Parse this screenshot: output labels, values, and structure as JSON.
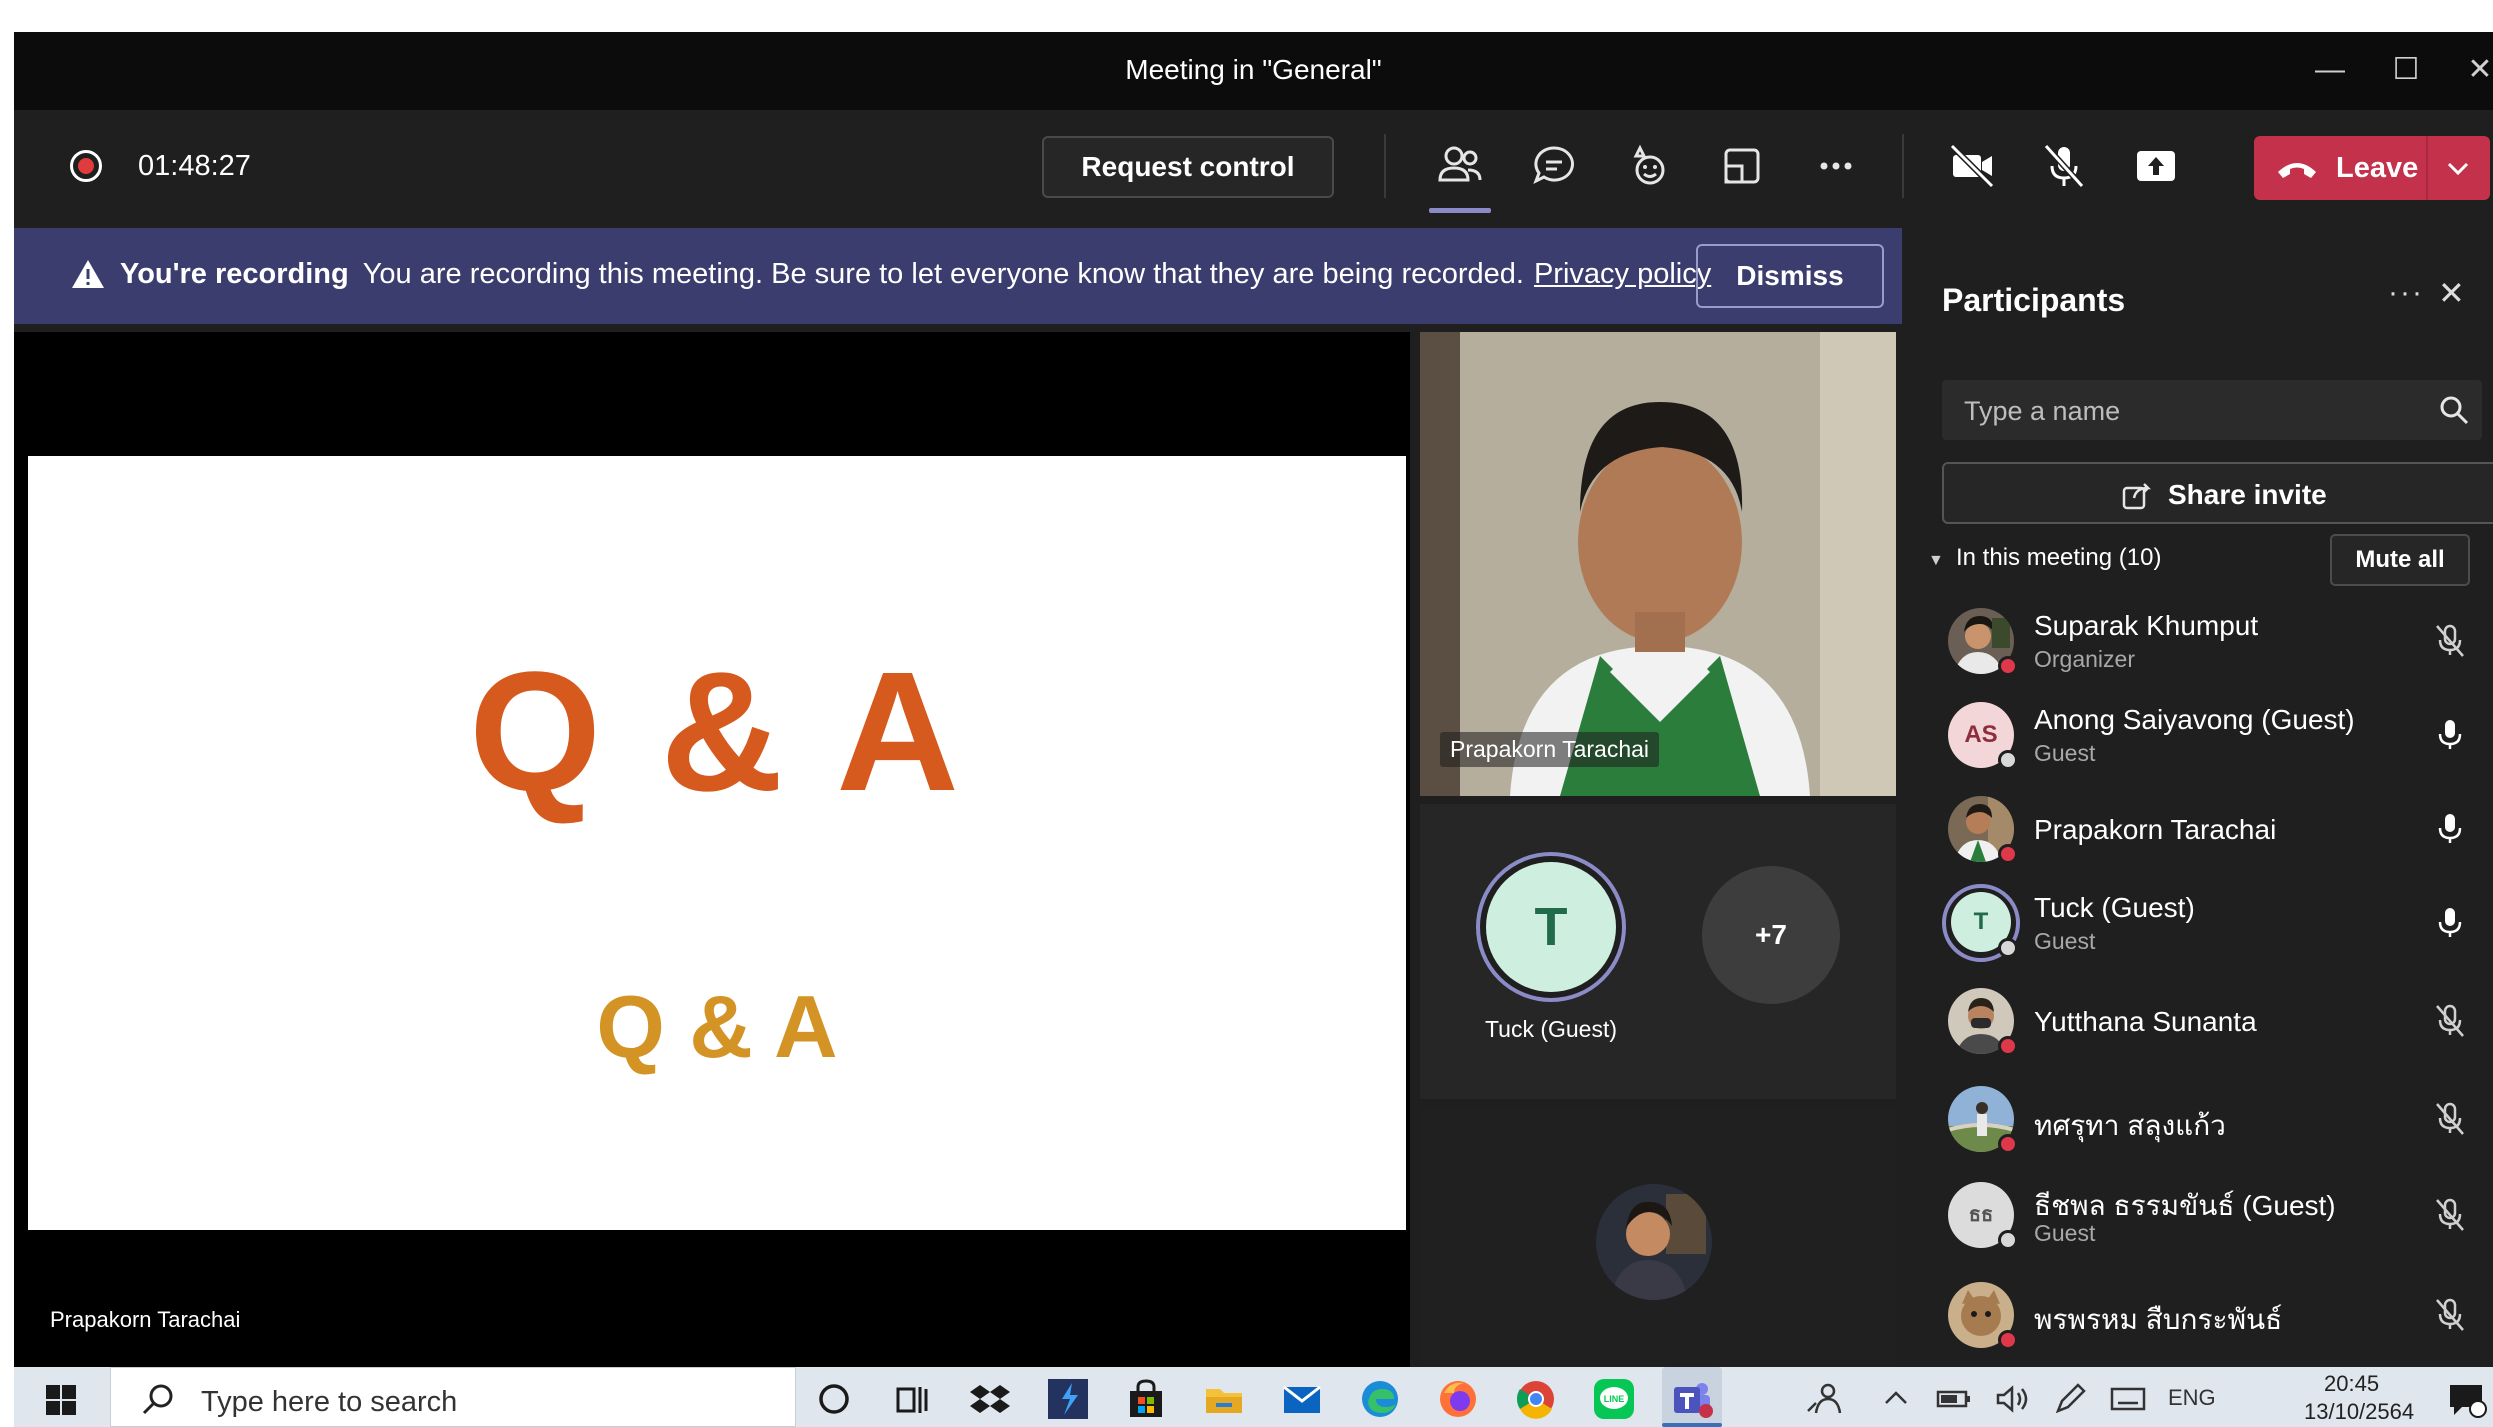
{
  "window": {
    "title": "Meeting in \"General\"",
    "controls": [
      "minimize-icon",
      "maximize-icon",
      "close-icon"
    ]
  },
  "toolbar": {
    "timer": "01:48:27",
    "request_control_label": "Request control",
    "leave_label": "Leave",
    "icons": [
      "people-icon",
      "chat-icon",
      "reactions-icon",
      "rooms-icon",
      "more-icon",
      "camera-off-icon",
      "mic-off-icon",
      "share-tray-icon"
    ],
    "active_icon": "people-icon",
    "accent_color": "#8b8cc7",
    "leave_color": "#c4314b"
  },
  "banner": {
    "bold": "You're recording",
    "message": "You are recording this meeting. Be sure to let everyone know that they are being recorded.",
    "link": "Privacy policy",
    "dismiss_label": "Dismiss"
  },
  "stage": {
    "slide_title": "Q & A",
    "slide_subtitle": "Q & A",
    "presenter_name": "Prapakorn Tarachai"
  },
  "video": {
    "name": "Prapakorn Tarachai"
  },
  "gallery": {
    "tuck_initial": "T",
    "tuck_name": "Tuck (Guest)",
    "more_count": "+7"
  },
  "panel": {
    "title": "Participants",
    "search_placeholder": "Type a name",
    "share_invite_label": "Share invite",
    "section_label": "In this meeting (10)",
    "mute_all_label": "Mute all",
    "participants": [
      {
        "name": "Suparak Khumput",
        "role": "Organizer",
        "mic": "muted",
        "status": "busy"
      },
      {
        "name": "Anong Saiyavong (Guest)",
        "role": "Guest",
        "initials": "AS",
        "mic": "on",
        "status": "offline"
      },
      {
        "name": "Prapakorn Tarachai",
        "role": "",
        "mic": "on",
        "status": "busy"
      },
      {
        "name": "Tuck (Guest)",
        "role": "Guest",
        "initials": "T",
        "mic": "on",
        "status": "offline"
      },
      {
        "name": "Yutthana Sunanta",
        "role": "",
        "mic": "muted",
        "status": "busy"
      },
      {
        "name": "ทศรุทา สลุงแก้ว",
        "role": "",
        "mic": "muted",
        "status": "busy"
      },
      {
        "name": "ธีชพล ธรรมขันธ์ (Guest)",
        "role": "Guest",
        "initials": "ธธ",
        "mic": "muted",
        "status": "offline"
      },
      {
        "name": "พรพรหม สืบกระพันธ์",
        "role": "",
        "mic": "muted",
        "status": "busy"
      }
    ]
  },
  "taskbar": {
    "search_placeholder": "Type here to search",
    "apps": [
      "cortana-icon",
      "task-view-icon",
      "dropbox-icon",
      "visual-studio-icon",
      "store-icon",
      "file-explorer-icon",
      "mail-icon",
      "edge-icon",
      "firefox-icon",
      "chrome-icon",
      "line-icon",
      "teams-icon"
    ],
    "language": "ENG",
    "time": "20:45",
    "date": "13/10/2564"
  }
}
